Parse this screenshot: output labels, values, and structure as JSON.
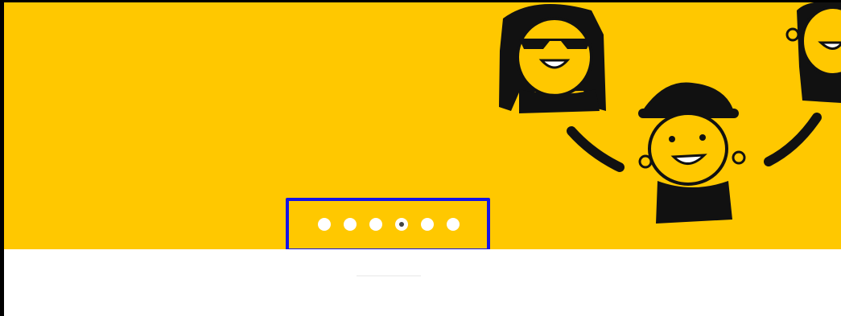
{
  "carousel": {
    "slide_count": 6,
    "active_index": 3,
    "dots": [
      {
        "label": "slide-1"
      },
      {
        "label": "slide-2"
      },
      {
        "label": "slide-3"
      },
      {
        "label": "slide-4"
      },
      {
        "label": "slide-5"
      },
      {
        "label": "slide-6"
      }
    ]
  },
  "colors": {
    "banner_bg": "#ffc800",
    "highlight": "#1414e6",
    "dot": "#ffffff",
    "dot_active_center": "#444444"
  },
  "icons": {
    "illustration": "cartoon-people-illustration"
  }
}
